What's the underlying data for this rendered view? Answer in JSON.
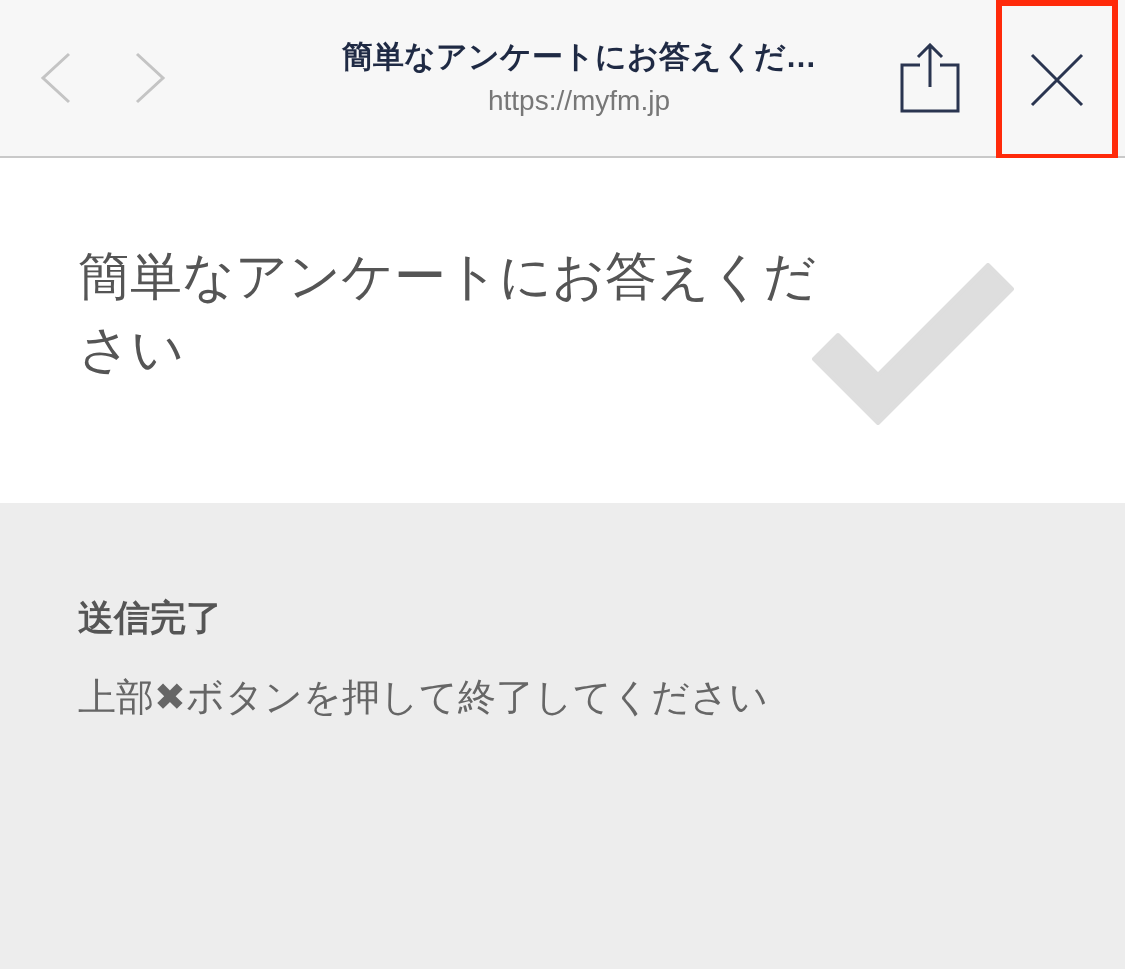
{
  "browser_bar": {
    "back": {
      "disabled": true
    },
    "forward": {
      "disabled": true
    },
    "title": "簡単なアンケートにお答えくだ…",
    "url": "https://myfm.jp",
    "close": {
      "highlighted": true
    }
  },
  "header": {
    "title": "簡単なアンケートにお答えください"
  },
  "message": {
    "heading": "送信完了",
    "body": "上部✖ボタンを押して終了してください"
  }
}
